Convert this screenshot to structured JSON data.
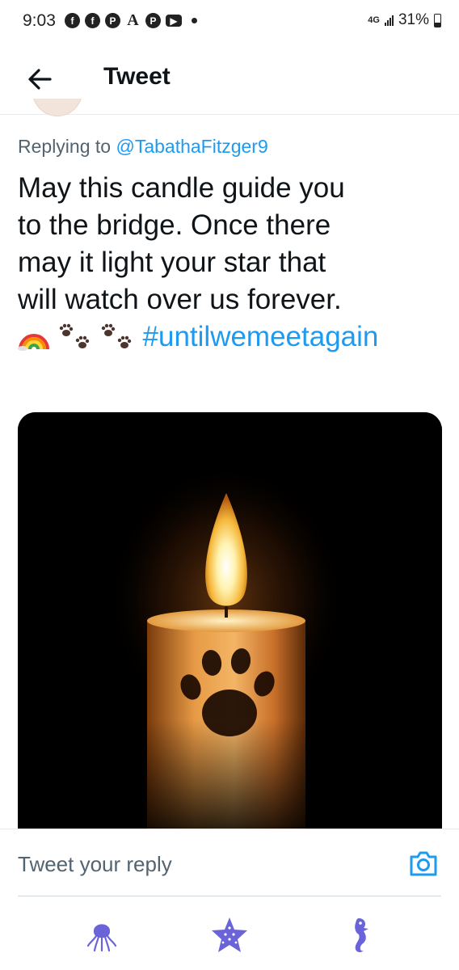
{
  "status_bar": {
    "time": "9:03",
    "network": "4G",
    "battery": "31%"
  },
  "header": {
    "title": "Tweet"
  },
  "tweet": {
    "replying_label": "Replying to",
    "replying_handle": "@TabathaFitzger9",
    "text_lines": [
      "May this candle guide you",
      "to the bridge.  Once there",
      "may it light your star that",
      "will watch over us forever."
    ],
    "emoji": [
      "rainbow",
      "paw-prints",
      "paw-prints"
    ],
    "hashtag": "#untilwemeetagain"
  },
  "reply": {
    "placeholder": "Tweet your reply"
  },
  "bottom_nav": {
    "items": [
      "octopus-icon",
      "star-icon",
      "seahorse-icon"
    ],
    "color": "#6b63d8"
  },
  "colors": {
    "accent": "#1d9bf0",
    "text": "#0f1419",
    "secondary_text": "#536471"
  }
}
